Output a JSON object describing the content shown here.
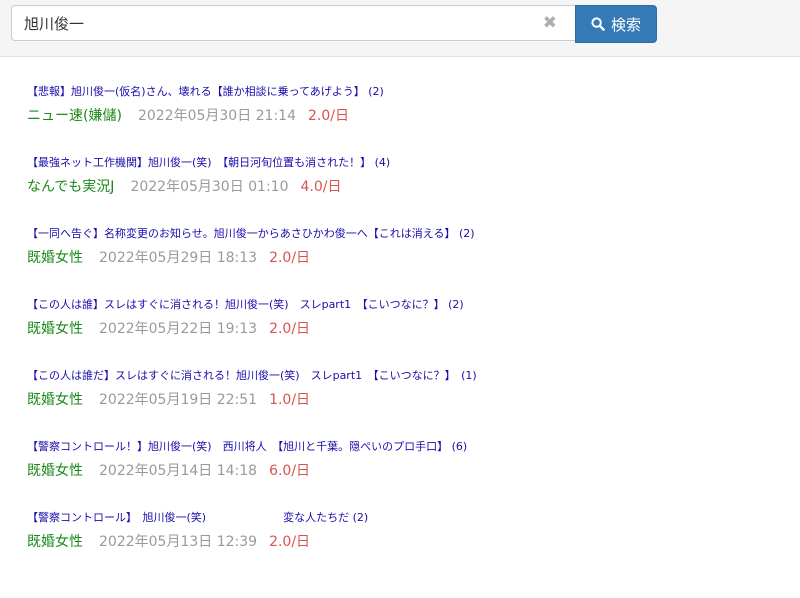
{
  "search": {
    "query": "旭川俊一",
    "button_label": "検索",
    "clear_icon": "times-icon",
    "button_icon": "search-icon",
    "button_color": "#337ab7"
  },
  "results": [
    {
      "title": "【悲報】旭川俊一(仮名)さん、壊れる【誰か相談に乗ってあげよう】 (2)",
      "board": "ニュー速(嫌儲)",
      "date": "2022年05月30日 21:14",
      "rate": "2.0/日"
    },
    {
      "title": "【最強ネット工作機関】旭川俊一(笑)　【朝日河旬位置も消された！】 (4)",
      "board": "なんでも実況J",
      "date": "2022年05月30日 01:10",
      "rate": "4.0/日"
    },
    {
      "title": "【一同へ告ぐ】名称変更のお知らせ。旭川俊一からあさひかわ俊一へ【これは消える】 (2)",
      "board": "既婚女性",
      "date": "2022年05月29日 18:13",
      "rate": "2.0/日"
    },
    {
      "title": "【この人は誰】スレはすぐに消される！旭川俊一(笑)　スレpart1　【こいつなに？】 (2)",
      "board": "既婚女性",
      "date": "2022年05月22日 19:13",
      "rate": "2.0/日"
    },
    {
      "title": "【この人は誰だ】スレはすぐに消される！旭川俊一(笑)　スレpart1　【こいつなに？】　(1)",
      "board": "既婚女性",
      "date": "2022年05月19日 22:51",
      "rate": "1.0/日"
    },
    {
      "title": "【警察コントロール！】旭川俊一(笑)　西川将人　【旭川と千葉。隠ぺいのプロ手口】 (6)",
      "board": "既婚女性",
      "date": "2022年05月14日 14:18",
      "rate": "6.0/日"
    },
    {
      "title": "【警察コントロール】　旭川俊一(笑)　　　　　　　変な人たちだ (2)",
      "board": "既婚女性",
      "date": "2022年05月13日 12:39",
      "rate": "2.0/日"
    }
  ]
}
